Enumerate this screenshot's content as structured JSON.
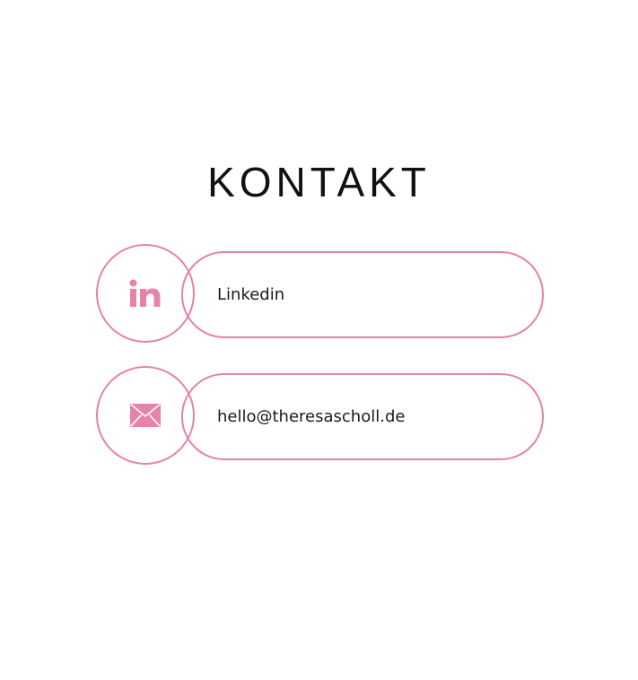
{
  "page": {
    "title": "KONTAKT"
  },
  "contacts": [
    {
      "icon": "linkedin-icon",
      "label": "Linkedin"
    },
    {
      "icon": "mail-icon",
      "label": "hello@theresascholl.de"
    }
  ],
  "colors": {
    "accent": "#e583a8",
    "text": "#1a1a1a",
    "background": "#ffffff"
  }
}
